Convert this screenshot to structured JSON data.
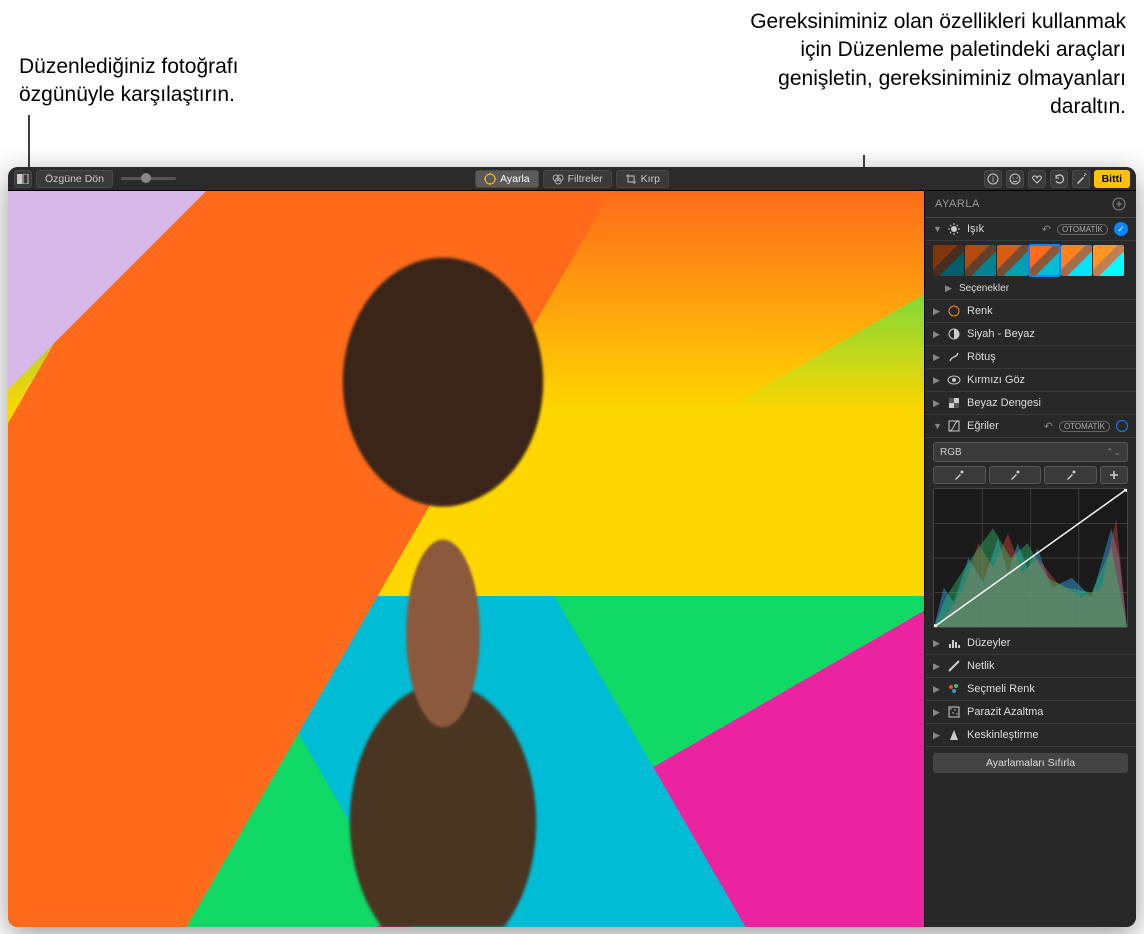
{
  "callouts": {
    "left": "Düzenlediğiniz fotoğrafı özgünüyle karşılaştırın.",
    "right": "Gereksiniminiz olan özellikleri kullanmak için Düzenleme paletindeki araçları genişletin, gereksiniminiz olmayanları daraltın."
  },
  "toolbar": {
    "revert": "Özgüne Dön",
    "adjust": "Ayarla",
    "filters": "Filtreler",
    "crop": "Kırp",
    "done": "Bitti"
  },
  "sidebar": {
    "header": "AYARLA",
    "auto_label": "OTOMATİK",
    "panels": {
      "light": "Işık",
      "options": "Seçenekler",
      "color": "Renk",
      "bw": "Siyah - Beyaz",
      "retouch": "Rötuş",
      "redeye": "Kırmızı Göz",
      "wb": "Beyaz Dengesi",
      "curves": "Eğriler",
      "curves_mode": "RGB",
      "levels": "Düzeyler",
      "definition": "Netlik",
      "selcolor": "Seçmeli Renk",
      "noise": "Parazit Azaltma",
      "sharpen": "Keskinleştirme"
    },
    "reset": "Ayarlamaları Sıfırla"
  }
}
